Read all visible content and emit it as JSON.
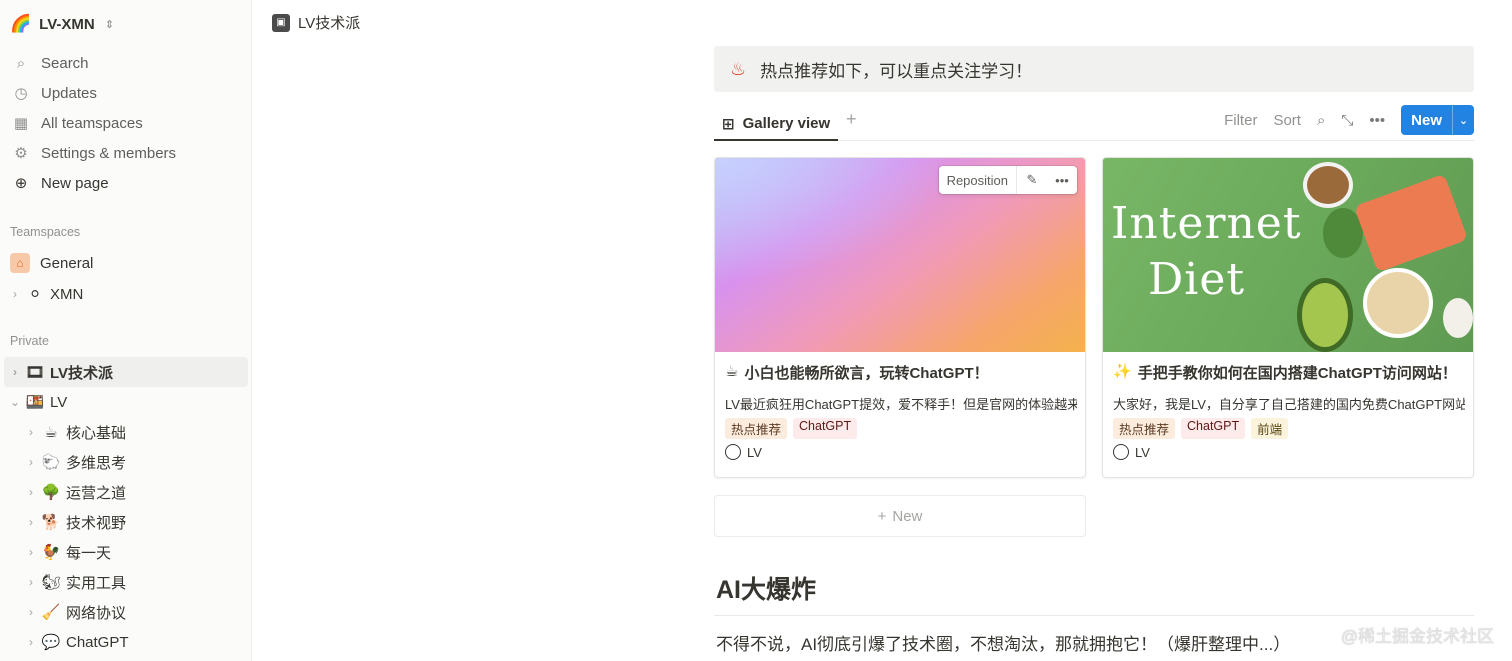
{
  "sidebar": {
    "workspace": {
      "logo": "🌈",
      "name": "LV-XMN",
      "switcher": "⇕"
    },
    "nav": [
      {
        "icon": "⌕",
        "icon_name": "search-icon",
        "label": "Search"
      },
      {
        "icon": "◷",
        "icon_name": "clock-icon",
        "label": "Updates"
      },
      {
        "icon": "▦",
        "icon_name": "building-icon",
        "label": "All teamspaces"
      },
      {
        "icon": "⚙",
        "icon_name": "gear-icon",
        "label": "Settings & members"
      },
      {
        "icon": "⊕",
        "icon_name": "plus-circle-icon",
        "label": "New page"
      }
    ],
    "teamspaces_header": "Teamspaces",
    "teamspaces": [
      {
        "icon": "⌂",
        "label": "General"
      },
      {
        "icon": "⚪",
        "label": "XMN"
      }
    ],
    "private_header": "Private",
    "private": [
      {
        "icon": "🎞",
        "label": "LV技术派"
      },
      {
        "icon": "🍱",
        "label": "LV"
      }
    ],
    "children": [
      {
        "icon": "☕",
        "label": "核心基础"
      },
      {
        "icon": "🐑",
        "label": "多维思考"
      },
      {
        "icon": "🌳",
        "label": "运营之道"
      },
      {
        "icon": "🐕",
        "label": "技术视野"
      },
      {
        "icon": "🐓",
        "label": "每一天"
      },
      {
        "icon": "🐿",
        "label": "实用工具"
      },
      {
        "icon": "🧹",
        "label": "网络协议"
      },
      {
        "icon": "💬",
        "label": "ChatGPT"
      }
    ]
  },
  "topbar": {
    "breadcrumb": "LV技术派"
  },
  "callout": {
    "emoji": "♨",
    "text": "热点推荐如下，可以重点关注学习！"
  },
  "view": {
    "tab_label": "Gallery view",
    "add_view": "+",
    "filter": "Filter",
    "sort": "Sort",
    "new_label": "New",
    "new_arrow": "⌄"
  },
  "cards": [
    {
      "emoji": "☕",
      "title": "小白也能畅所欲言，玩转ChatGPT！",
      "desc": "LV最近疯狂用ChatGPT提效，爱不释手！但是官网的体验越来越",
      "tags": [
        "热点推荐",
        "ChatGPT"
      ],
      "owner": "LV",
      "reposition": "Reposition"
    },
    {
      "emoji": "✨",
      "title": "手把手教你如何在国内搭建ChatGPT访问网站！",
      "desc": "大家好，我是LV，自分享了自己搭建的国内免费ChatGPT网站之",
      "tags": [
        "热点推荐",
        "ChatGPT",
        "前端"
      ],
      "owner": "LV",
      "cover_line1": "Internet",
      "cover_line2": "Diet"
    }
  ],
  "new_card_label": "New",
  "section_heading": "AI大爆炸",
  "paragraph": "不得不说，AI彻底引爆了技术圈，不想淘汰，那就拥抱它！（爆肝整理中...）",
  "watermark": "@稀土掘金技术社区",
  "colors": {
    "accent": "#2383e2",
    "sidebar_bg": "#fbfbfa",
    "callout_bg": "#f1f1ef"
  }
}
